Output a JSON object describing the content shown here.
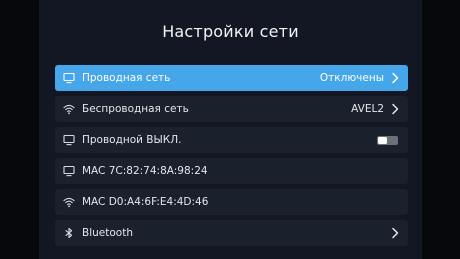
{
  "screen": {
    "title": "Настройки сети"
  },
  "rows": [
    {
      "icon": "monitor-icon",
      "label": "Проводная сеть",
      "value": "Отключены",
      "active": true
    },
    {
      "icon": "wifi-icon",
      "label": "Беспроводная сеть",
      "value": "AVEL2",
      "active": false
    },
    {
      "icon": "monitor-icon",
      "label": "Проводной ВЫКЛ.",
      "value": "",
      "active": false,
      "toggle_on": false
    },
    {
      "icon": "monitor-icon",
      "label": "MAC  7C:82:74:8A:98:24",
      "value": "",
      "active": false
    },
    {
      "icon": "wifi-icon",
      "label": "MAC  D0:A4:6F:E4:4D:46",
      "value": "",
      "active": false
    },
    {
      "icon": "bluetooth-icon",
      "label": "Bluetooth",
      "value": "",
      "active": false
    }
  ],
  "colors": {
    "accent": "#45a6ea",
    "panel": "#131723",
    "row": "#1b202d"
  }
}
